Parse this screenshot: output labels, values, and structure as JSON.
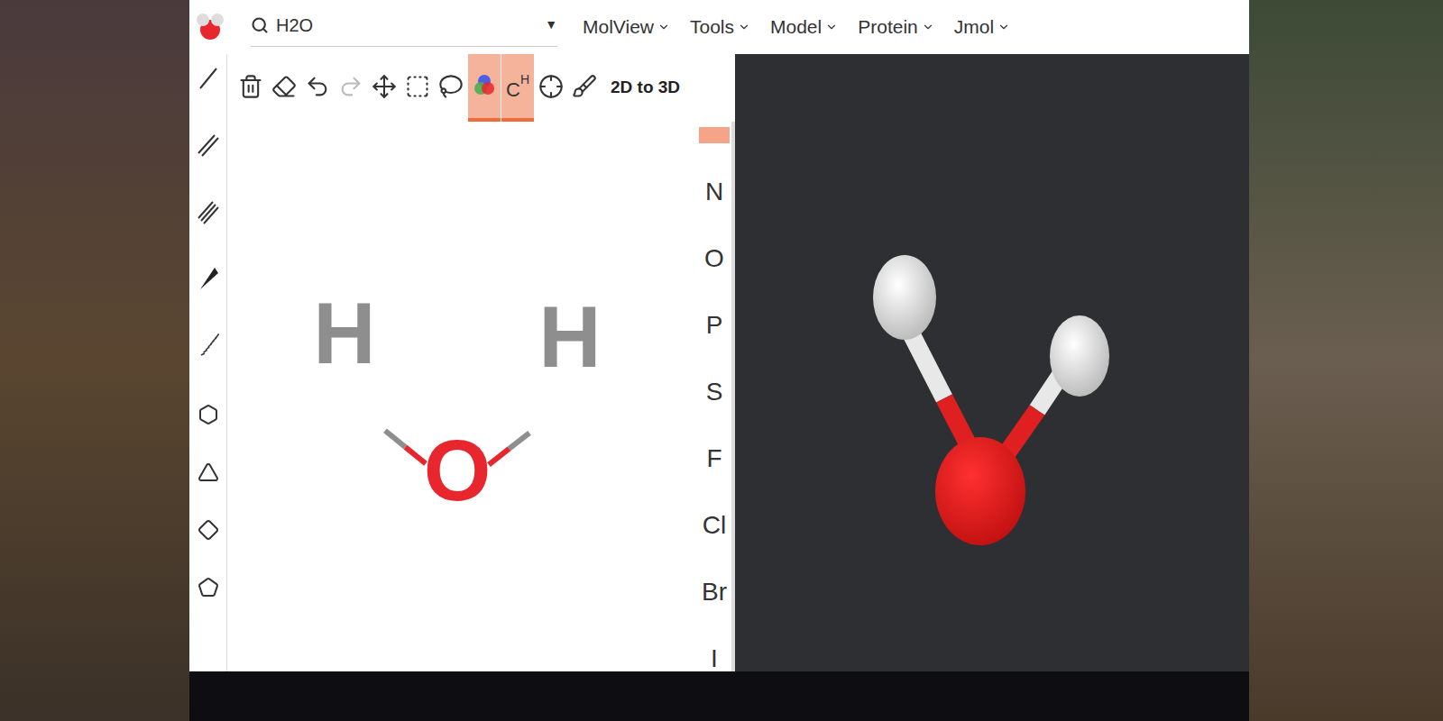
{
  "search": {
    "value": "H2O",
    "dropdown": "▼"
  },
  "menus": [
    "MolView",
    "Tools",
    "Model",
    "Protein",
    "Jmol"
  ],
  "toolbar": [
    {
      "name": "trash",
      "selected": false
    },
    {
      "name": "eraser",
      "selected": false
    },
    {
      "name": "undo",
      "selected": false
    },
    {
      "name": "redo",
      "selected": false,
      "disabled": true
    },
    {
      "name": "move",
      "selected": false
    },
    {
      "name": "rect-select",
      "selected": false
    },
    {
      "name": "lasso-select",
      "selected": false
    },
    {
      "name": "color",
      "selected": true
    },
    {
      "name": "hydrogens",
      "label": "C",
      "sup": "H",
      "selected": true
    },
    {
      "name": "center",
      "selected": false
    },
    {
      "name": "clean",
      "selected": false
    }
  ],
  "convert_button": "2D to 3D",
  "elements": [
    "N",
    "O",
    "P",
    "S",
    "F",
    "Cl",
    "Br",
    "I"
  ],
  "sketch": {
    "atoms": [
      {
        "label": "H",
        "color": "#8e8e8e"
      },
      {
        "label": "O",
        "color": "#e8262e"
      },
      {
        "label": "H",
        "color": "#8e8e8e"
      }
    ]
  }
}
